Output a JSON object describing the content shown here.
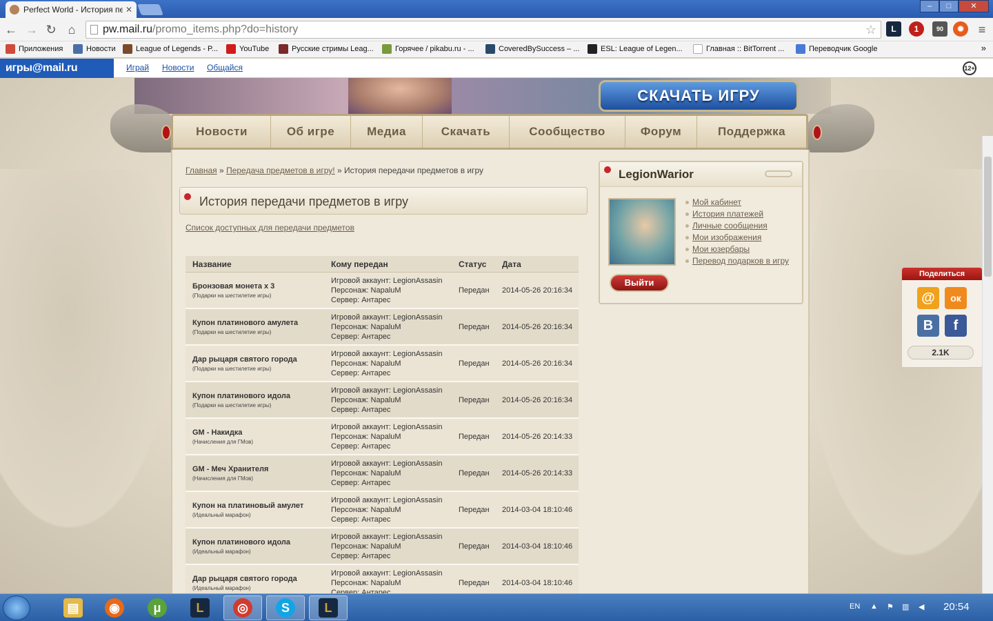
{
  "browser": {
    "tab_title": "Perfect World - История пер",
    "tab_close": "✕",
    "url_host": "pw.mail.ru",
    "url_path": "/promo_items.php?do=history",
    "ext_badge_1": "1",
    "ext_badge_2": "90"
  },
  "bookmarks": [
    {
      "label": "Приложения",
      "icon": "apps-icon",
      "color": "#d14b3a"
    },
    {
      "label": "Новости",
      "icon": "vk-icon",
      "color": "#4a6fa5"
    },
    {
      "label": "League of Legends - P...",
      "icon": "lol-icon",
      "color": "#7a4a2a"
    },
    {
      "label": "YouTube",
      "icon": "youtube-icon",
      "color": "#d21b1b"
    },
    {
      "label": "Русские стримы Leag...",
      "icon": "stream-icon",
      "color": "#7a2a2a"
    },
    {
      "label": "Горячее / pikabu.ru - ...",
      "icon": "pikabu-icon",
      "color": "#7a9a3a"
    },
    {
      "label": "CoveredBySuccess – ...",
      "icon": "covered-icon",
      "color": "#2a4a6a"
    },
    {
      "label": "ESL: League of Legen...",
      "icon": "esl-icon",
      "color": "#222222"
    },
    {
      "label": "Главная :: BitTorrent ...",
      "icon": "page-icon",
      "color": "#dddddd"
    },
    {
      "label": "Переводчик Google",
      "icon": "translate-icon",
      "color": "#4a7ad5"
    }
  ],
  "portal": {
    "logo": "игры@mail.ru",
    "links": [
      "Играй",
      "Новости",
      "Общайся"
    ],
    "age": "12+"
  },
  "site": {
    "download_button": "СКАЧАТЬ ИГРУ",
    "menu": [
      "Новости",
      "Об игре",
      "Медиа",
      "Скачать",
      "Сообщество",
      "Форум",
      "Поддержка"
    ]
  },
  "breadcrumbs": {
    "home": "Главная",
    "sep": "»",
    "section": "Передача предметов в игру!",
    "current": "История передачи предметов в игру"
  },
  "page_title": "История передачи предметов в игру",
  "available_link": "Список доступных для передачи предметов",
  "table": {
    "headers": [
      "Название",
      "Кому передан",
      "Статус",
      "Дата"
    ],
    "rows": [
      {
        "name": "Бронзовая монета x 3",
        "note": "(Подарки на шестилетие игры)",
        "account": "Игровой аккаунт: LegionAssasin",
        "character": "Персонаж: NapaluM",
        "server": "Сервер: Антарес",
        "status": "Передан",
        "date": "2014-05-26 20:16:34"
      },
      {
        "name": "Купон платинового амулета",
        "note": "(Подарки на шестилетие игры)",
        "account": "Игровой аккаунт: LegionAssasin",
        "character": "Персонаж: NapaluM",
        "server": "Сервер: Антарес",
        "status": "Передан",
        "date": "2014-05-26 20:16:34"
      },
      {
        "name": "Дар рыцаря святого города",
        "note": "(Подарки на шестилетие игры)",
        "account": "Игровой аккаунт: LegionAssasin",
        "character": "Персонаж: NapaluM",
        "server": "Сервер: Антарес",
        "status": "Передан",
        "date": "2014-05-26 20:16:34"
      },
      {
        "name": "Купон платинового идола",
        "note": "(Подарки на шестилетие игры)",
        "account": "Игровой аккаунт: LegionAssasin",
        "character": "Персонаж: NapaluM",
        "server": "Сервер: Антарес",
        "status": "Передан",
        "date": "2014-05-26 20:16:34"
      },
      {
        "name": "GM - Накидка",
        "note": "(Начисления для ГМов)",
        "account": "Игровой аккаунт: LegionAssasin",
        "character": "Персонаж: NapaluM",
        "server": "Сервер: Антарес",
        "status": "Передан",
        "date": "2014-05-26 20:14:33"
      },
      {
        "name": "GM - Меч Хранителя",
        "note": "(Начисления для ГМов)",
        "account": "Игровой аккаунт: LegionAssasin",
        "character": "Персонаж: NapaluM",
        "server": "Сервер: Антарес",
        "status": "Передан",
        "date": "2014-05-26 20:14:33"
      },
      {
        "name": "Купон на платиновый амулет",
        "note": "(Идеальный марафон)",
        "account": "Игровой аккаунт: LegionAssasin",
        "character": "Персонаж: NapaluM",
        "server": "Сервер: Антарес",
        "status": "Передан",
        "date": "2014-03-04 18:10:46"
      },
      {
        "name": "Купон платинового идола",
        "note": "(Идеальный марафон)",
        "account": "Игровой аккаунт: LegionAssasin",
        "character": "Персонаж: NapaluM",
        "server": "Сервер: Антарес",
        "status": "Передан",
        "date": "2014-03-04 18:10:46"
      },
      {
        "name": "Дар рыцаря святого города",
        "note": "(Идеальный марафон)",
        "account": "Игровой аккаунт: LegionAssasin",
        "character": "Персонаж: NapaluM",
        "server": "Сервер: Антарес",
        "status": "Передан",
        "date": "2014-03-04 18:10:46"
      }
    ]
  },
  "user": {
    "name": "LegionWarior",
    "links": [
      "Мой кабинет",
      "История платежей",
      "Личные сообщения",
      "Мои изображения",
      "Мои юзербары",
      "Перевод подарков в игру"
    ],
    "logout": "Выйти"
  },
  "share": {
    "title": "Поделиться",
    "count": "2.1K",
    "buttons": [
      {
        "icon": "mailru-icon",
        "glyph": "@",
        "color": "#f0a21c"
      },
      {
        "icon": "odnoklassniki-icon",
        "glyph": "ок",
        "color": "#f08a1c"
      },
      {
        "icon": "vk-icon",
        "glyph": "В",
        "color": "#4a6fa5"
      },
      {
        "icon": "facebook-icon",
        "glyph": "f",
        "color": "#3b5998"
      }
    ]
  },
  "taskbar": {
    "apps": [
      {
        "icon": "explorer-icon",
        "glyph": "▤",
        "color": "#e5b94a"
      },
      {
        "icon": "firefox-icon",
        "glyph": "◉",
        "color": "#e66a1a"
      },
      {
        "icon": "utorrent-icon",
        "glyph": "μ",
        "color": "#5aa23a"
      },
      {
        "icon": "league-icon",
        "glyph": "L",
        "color": "#16283f"
      },
      {
        "icon": "chrome-icon",
        "glyph": "◎",
        "color": "#d23b2f"
      },
      {
        "icon": "skype-icon",
        "glyph": "S",
        "color": "#12a5e5"
      },
      {
        "icon": "league-icon",
        "glyph": "L",
        "color": "#16283f"
      }
    ],
    "lang": "EN",
    "clock": "20:54"
  }
}
